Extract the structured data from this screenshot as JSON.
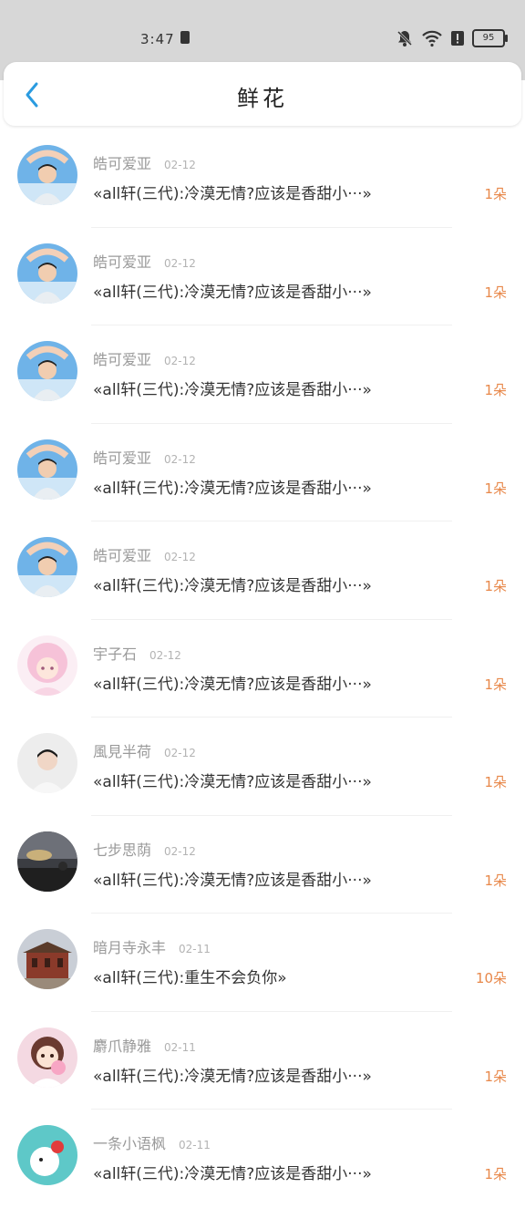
{
  "status_bar": {
    "time": "3:47",
    "battery": "95"
  },
  "header": {
    "title": "鲜花"
  },
  "items": [
    {
      "name": "皓可爱亚",
      "date": "02-12",
      "message": "«all轩(三代):冷漠无情?应该是香甜小···»",
      "count": "1朵",
      "avatar": "boy-heart-sky"
    },
    {
      "name": "皓可爱亚",
      "date": "02-12",
      "message": "«all轩(三代):冷漠无情?应该是香甜小···»",
      "count": "1朵",
      "avatar": "boy-heart-sky"
    },
    {
      "name": "皓可爱亚",
      "date": "02-12",
      "message": "«all轩(三代):冷漠无情?应该是香甜小···»",
      "count": "1朵",
      "avatar": "boy-heart-sky"
    },
    {
      "name": "皓可爱亚",
      "date": "02-12",
      "message": "«all轩(三代):冷漠无情?应该是香甜小···»",
      "count": "1朵",
      "avatar": "boy-heart-sky"
    },
    {
      "name": "皓可爱亚",
      "date": "02-12",
      "message": "«all轩(三代):冷漠无情?应该是香甜小···»",
      "count": "1朵",
      "avatar": "boy-heart-sky"
    },
    {
      "name": "宇子石",
      "date": "02-12",
      "message": "«all轩(三代):冷漠无情?应该是香甜小···»",
      "count": "1朵",
      "avatar": "pink-anime-girl"
    },
    {
      "name": "風見半荷",
      "date": "02-12",
      "message": "«all轩(三代):冷漠无情?应该是香甜小···»",
      "count": "1朵",
      "avatar": "boy-white"
    },
    {
      "name": "七步思荫",
      "date": "02-12",
      "message": "«all轩(三代):冷漠无情?应该是香甜小···»",
      "count": "1朵",
      "avatar": "sunset-landscape"
    },
    {
      "name": "暗月寺永丰",
      "date": "02-11",
      "message": "«all轩(三代):重生不会负你»",
      "count": "10朵",
      "avatar": "temple-building"
    },
    {
      "name": "麝爪静雅",
      "date": "02-11",
      "message": "«all轩(三代):冷漠无情?应该是香甜小···»",
      "count": "1朵",
      "avatar": "anime-girl-bubble"
    },
    {
      "name": "一条小语枫",
      "date": "02-11",
      "message": "«all轩(三代):冷漠无情?应该是香甜小···»",
      "count": "1朵",
      "avatar": "cartoon-teal"
    }
  ]
}
